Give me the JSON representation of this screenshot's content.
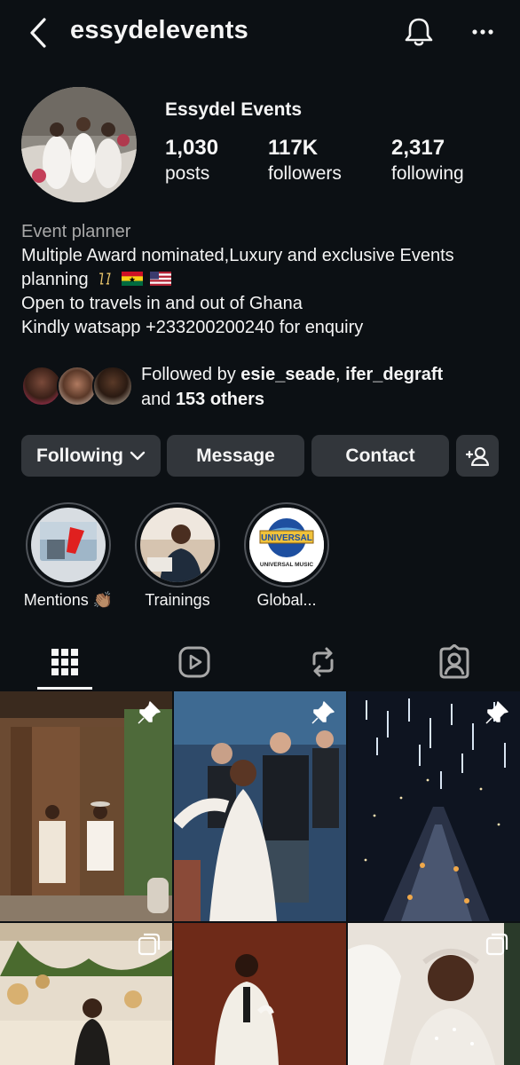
{
  "header": {
    "username": "essydelevents",
    "back_icon": "chevron-left-icon",
    "bell_icon": "bell-icon",
    "more_icon": "more-horizontal-icon"
  },
  "profile": {
    "display_name": "Essydel Events",
    "stats": [
      {
        "value": "1,030",
        "label": "posts"
      },
      {
        "value": "117K",
        "label": "followers"
      },
      {
        "value": "2,317",
        "label": "following"
      }
    ]
  },
  "bio": {
    "category": "Event planner",
    "line1": "Multiple Award nominated,Luxury and exclusive Events",
    "line2": "planning",
    "line3": "Open to travels in and out of Ghana",
    "line4": "Kindly watsapp +233200200240 for enquiry"
  },
  "followed_by": {
    "prefix": "Followed by",
    "user1": "esie_seade",
    "separator": ",",
    "user2": "ifer_degraft",
    "and": "and",
    "others": "153 others"
  },
  "actions": {
    "following": "Following",
    "message": "Message",
    "contact": "Contact"
  },
  "highlights": [
    {
      "label": "Mentions 👏🏽"
    },
    {
      "label": "Trainings"
    },
    {
      "label": "Global..."
    }
  ],
  "highlight_art": {
    "universal_title": "UNIVERSAL",
    "universal_sub": "UNIVERSAL MUSIC"
  },
  "tabs": [
    {
      "icon": "grid-icon",
      "active": true
    },
    {
      "icon": "reels-icon",
      "active": false
    },
    {
      "icon": "repost-icon",
      "active": false
    },
    {
      "icon": "tagged-icon",
      "active": false
    }
  ],
  "colors": {
    "background": "#0c1014",
    "button": "#32363b",
    "secondary_text": "#a8a8a8"
  }
}
